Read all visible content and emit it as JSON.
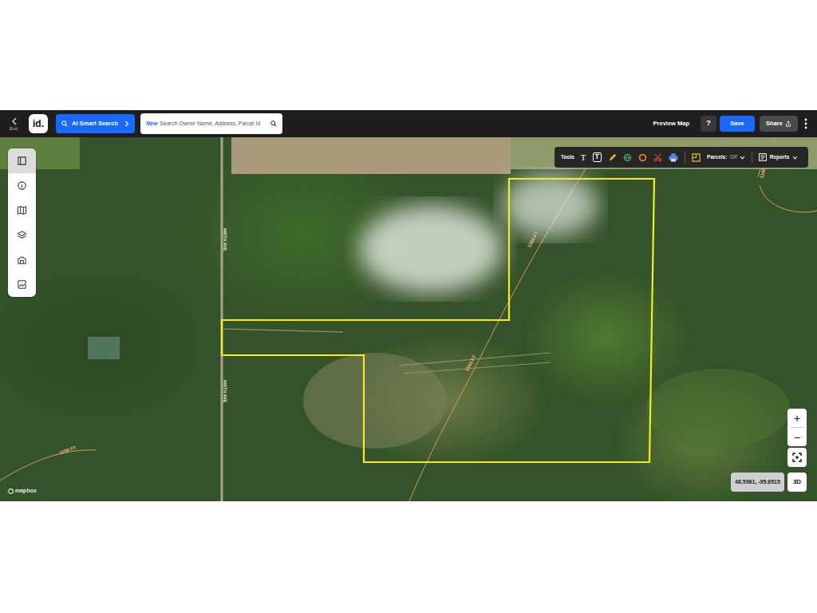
{
  "topbar": {
    "exit": "Exit",
    "logo": "id.",
    "smart_search": "AI Smart Search",
    "search": {
      "badge": "New",
      "placeholder": "Search Owner Name, Address, Parcel Id"
    },
    "preview": "Preview Map",
    "help": "?",
    "save": "Save",
    "share": "Share"
  },
  "left_tools": [
    {
      "selected": true
    },
    {
      "selected": false
    },
    {
      "selected": false
    },
    {
      "selected": false
    },
    {
      "selected": false
    },
    {
      "selected": false
    }
  ],
  "toolbar": {
    "label": "Tools",
    "text_tools": [
      "T",
      "T"
    ],
    "parcels_label": "Parcels:",
    "parcels_value": "Off",
    "reports": "Reports"
  },
  "map": {
    "roads": [
      "440TH AVE",
      "440TH AVE"
    ],
    "contours": [
      "1160 FT",
      "1160 FT",
      "1150 FT",
      "1160"
    ],
    "attribution": "mapbox",
    "coordinates": "48.5981, -95.6515",
    "zoom_in": "+",
    "zoom_out": "−",
    "view_3d": "3D"
  }
}
